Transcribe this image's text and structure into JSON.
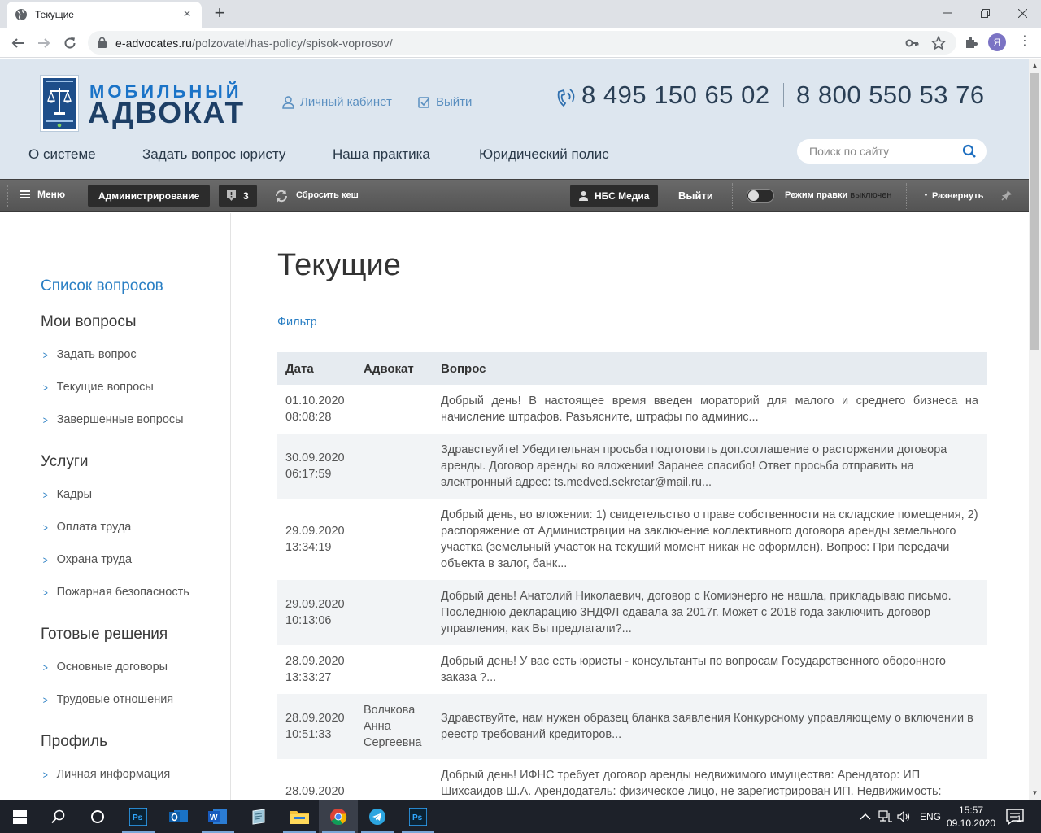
{
  "browser": {
    "tab_title": "Текущие",
    "url_domain": "e-advocates.ru",
    "url_path": "/polzovatel/has-policy/spisok-voprosov/",
    "avatar_letter": "Я"
  },
  "header": {
    "logo_line1": "МОБИЛЬНЫЙ",
    "logo_line2": "АДВОКАТ",
    "cabinet_link": "Личный кабинет",
    "logout_link": "Выйти",
    "phone1": "8 495 150 65 02",
    "phone2": "8 800 550 53 76",
    "nav": [
      "О системе",
      "Задать вопрос юристу",
      "Наша практика",
      "Юридический полис"
    ],
    "search_placeholder": "Поиск по сайту"
  },
  "adminbar": {
    "menu": "Меню",
    "admin": "Администрирование",
    "badge_count": "3",
    "reset_cache": "Сбросить кеш",
    "user": "НБС Медиа",
    "logout": "Выйти",
    "edit_mode": "Режим правки",
    "edit_mode_state": "выключен",
    "expand": "Развернуть"
  },
  "sidebar": {
    "list_questions": "Список вопросов",
    "my_questions": "Мои вопросы",
    "my_items": [
      "Задать вопрос",
      "Текущие вопросы",
      "Завершенные вопросы"
    ],
    "services": "Услуги",
    "services_items": [
      "Кадры",
      "Оплата труда",
      "Охрана труда",
      "Пожарная безопасность"
    ],
    "ready": "Готовые решения",
    "ready_items": [
      "Основные договоры",
      "Трудовые отношения"
    ],
    "profile": "Профиль",
    "profile_items": [
      "Личная информация"
    ]
  },
  "main": {
    "title": "Текущие",
    "filter": "Фильтр",
    "columns": [
      "Дата",
      "Адвокат",
      "Вопрос"
    ],
    "rows": [
      {
        "date": "01.10.2020",
        "time": "08:08:28",
        "lawyer": "",
        "question": "Добрый день! В настоящее время введен мораторий для малого и среднего бизнеса на начисление штрафов. Разъясните, штрафы по админис..."
      },
      {
        "date": "30.09.2020",
        "time": "06:17:59",
        "lawyer": "",
        "question": "Здравствуйте! Убедительная просьба подготовить доп.соглашение о расторжении договора аренды. Договор аренды во вложении! Заранее спасибо! Ответ просьба отправить на электронный адрес: ts.medved.sekretar@mail.ru..."
      },
      {
        "date": "29.09.2020",
        "time": "13:34:19",
        "lawyer": "",
        "question": "Добрый день, во вложении: 1) свидетельство о праве собственности на складские помещения, 2) распоряжение от Администрации на заключение коллективного договора аренды земельного участка (земельный участок на текущий момент никак не оформлен). Вопрос: При передачи объекта в залог, банк..."
      },
      {
        "date": "29.09.2020",
        "time": "10:13:06",
        "lawyer": "",
        "question": "Добрый день! Анатолий Николаевич, договор с Комиэнерго не нашла, прикладываю письмо. Последнюю декларацию 3НДФЛ сдавала за 2017г. Может с 2018 года заключить договор управления, как Вы предлагали?..."
      },
      {
        "date": "28.09.2020",
        "time": "13:33:27",
        "lawyer": "",
        "question": "Добрый день! У вас есть юристы - консультанты по вопросам Государственного оборонного заказа ?..."
      },
      {
        "date": "28.09.2020",
        "time": "10:51:33",
        "lawyer": "Волчкова Анна Сергеевна",
        "question": "Здравствуйте, нам нужен образец бланка заявления Конкурсному управляющему о включении в реестр требований кредиторов..."
      },
      {
        "date": "28.09.2020",
        "time": "",
        "lawyer": "",
        "question": "Добрый день! ИФНС требует договор аренды недвижимого имущества: Арендатор: ИП Шихсаидов Ш.А. Арендодатель: физическое лицо, не зарегистрирован ИП. Недвижимость:"
      }
    ]
  },
  "taskbar": {
    "lang": "ENG",
    "time": "15:57",
    "date": "09.10.2020",
    "notif_count": "1"
  }
}
